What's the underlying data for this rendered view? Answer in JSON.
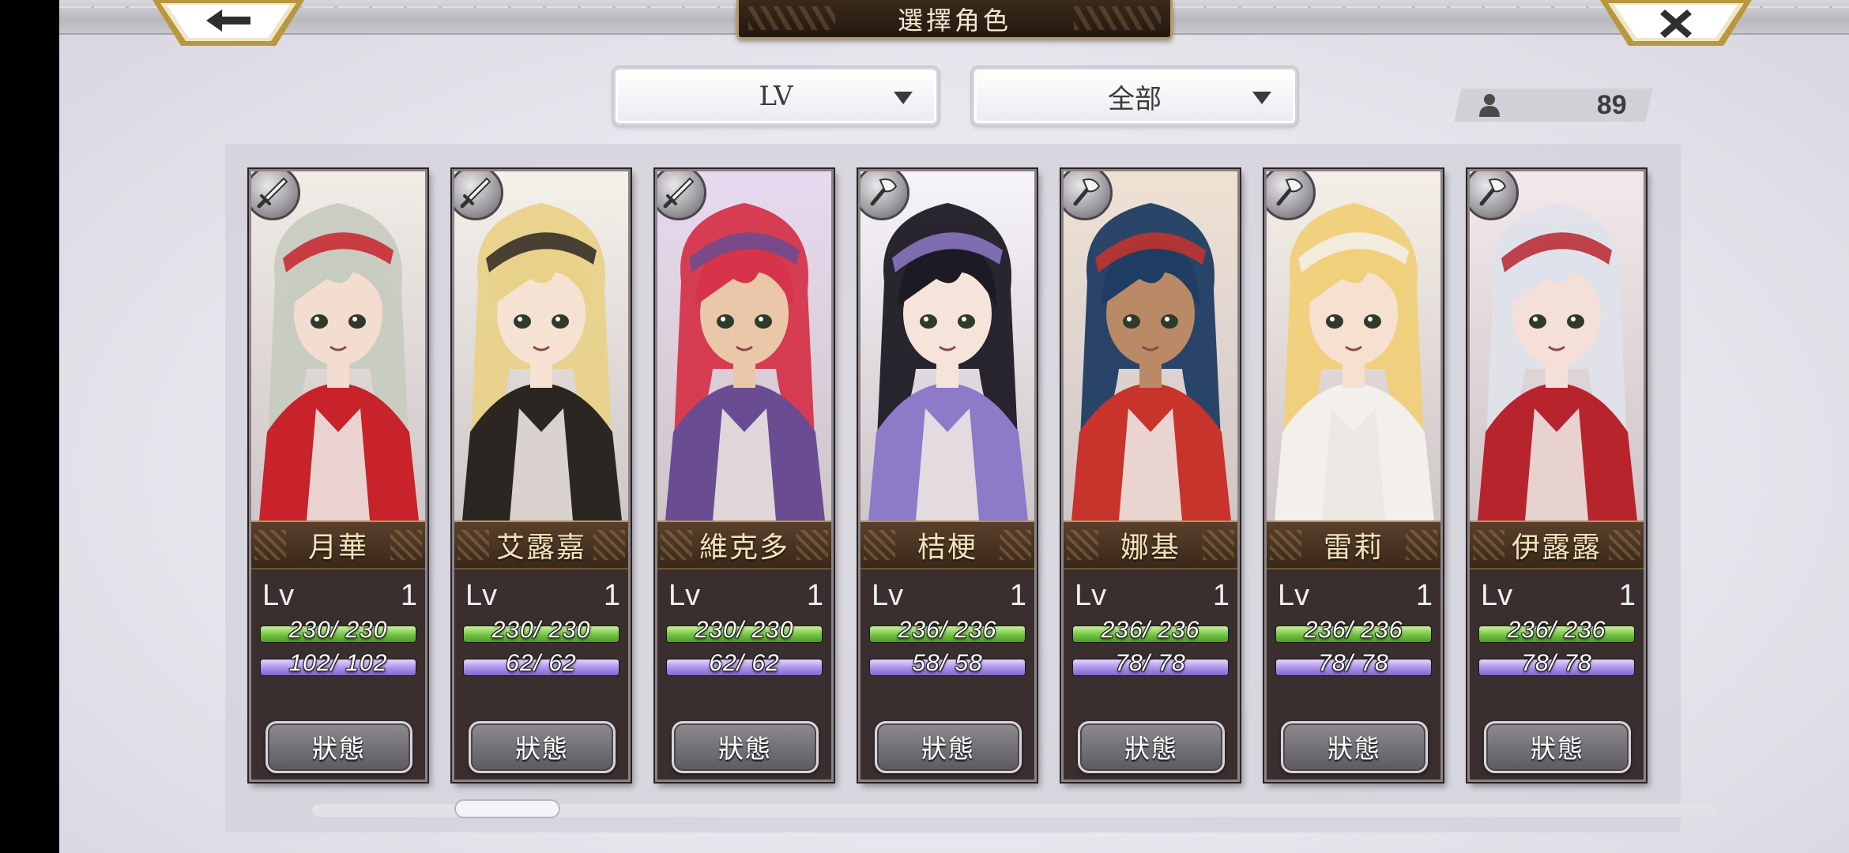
{
  "header": {
    "title": "選擇角色"
  },
  "filters": {
    "sort_label": "LV",
    "filter_label": "全部"
  },
  "roster": {
    "count": "89"
  },
  "characters": [
    {
      "name": "月華",
      "lv_label": "Lv",
      "lv": "1",
      "hp": "230/ 230",
      "mp": "102/ 102",
      "status_label": "狀態",
      "hair": "#c7cbc0",
      "accent": "#c8222b",
      "skin": "#f3ddd0",
      "weapon": "sword"
    },
    {
      "name": "艾露嘉",
      "lv_label": "Lv",
      "lv": "1",
      "hp": "230/ 230",
      "mp": "62/ 62",
      "status_label": "狀態",
      "hair": "#e8d28a",
      "accent": "#2b2622",
      "skin": "#f6e2d2",
      "weapon": "sword"
    },
    {
      "name": "維克多",
      "lv_label": "Lv",
      "lv": "1",
      "hp": "230/ 230",
      "mp": "62/ 62",
      "status_label": "狀態",
      "hair": "#d5344a",
      "accent": "#6a4c92",
      "skin": "#e9c7a8",
      "weapon": "sword"
    },
    {
      "name": "桔梗",
      "lv_label": "Lv",
      "lv": "1",
      "hp": "236/ 236",
      "mp": "58/ 58",
      "status_label": "狀態",
      "hair": "#1c1a24",
      "accent": "#8d7ac8",
      "skin": "#f6e4da",
      "weapon": "axe"
    },
    {
      "name": "娜基",
      "lv_label": "Lv",
      "lv": "1",
      "hp": "236/ 236",
      "mp": "78/ 78",
      "status_label": "狀態",
      "hair": "#1f3c62",
      "accent": "#c8332c",
      "skin": "#b98a65",
      "weapon": "axe"
    },
    {
      "name": "雷莉",
      "lv_label": "Lv",
      "lv": "1",
      "hp": "236/ 236",
      "mp": "78/ 78",
      "status_label": "狀態",
      "hair": "#f0d07a",
      "accent": "#f3f0ec",
      "skin": "#f6e0cf",
      "weapon": "axe"
    },
    {
      "name": "伊露露",
      "lv_label": "Lv",
      "lv": "1",
      "hp": "236/ 236",
      "mp": "78/ 78",
      "status_label": "狀態",
      "hair": "#dfe2ea",
      "accent": "#b8242e",
      "skin": "#f4e0d8",
      "weapon": "axe"
    }
  ],
  "icons": {
    "back": "arrow-left-icon",
    "close": "close-icon",
    "dropdown": "chevron-down-icon",
    "count": "person-icon",
    "sword": "sword-icon",
    "axe": "axe-icon"
  },
  "colors": {
    "hp_bar": "#6bbf3a",
    "mp_bar": "#a58ae8",
    "name_plate": "#4a3322",
    "gold_trim": "#b89a5a"
  }
}
